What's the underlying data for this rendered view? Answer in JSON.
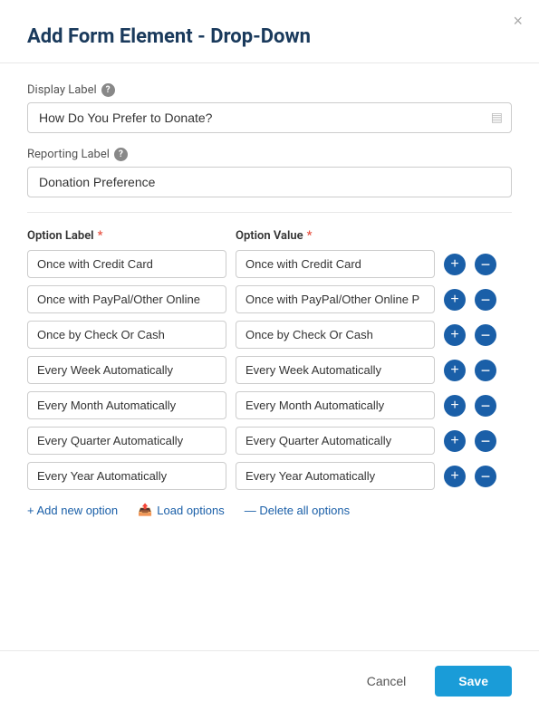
{
  "modal": {
    "title": "Add Form Element - Drop-Down",
    "close_label": "×"
  },
  "display_label": {
    "label": "Display Label",
    "value": "How Do You Prefer to Donate?"
  },
  "reporting_label": {
    "label": "Reporting Label",
    "value": "Donation Preference"
  },
  "options_section": {
    "label_col_header": "Option Label",
    "value_col_header": "Option Value",
    "required_marker": "*",
    "rows": [
      {
        "label": "Once with Credit Card",
        "value": "Once with Credit Card"
      },
      {
        "label": "Once with PayPal/Other Online",
        "value": "Once with PayPal/Other Online P"
      },
      {
        "label": "Once by Check Or Cash",
        "value": "Once by Check Or Cash"
      },
      {
        "label": "Every Week Automatically",
        "value": "Every Week Automatically"
      },
      {
        "label": "Every Month Automatically",
        "value": "Every Month Automatically"
      },
      {
        "label": "Every Quarter Automatically",
        "value": "Every Quarter Automatically"
      },
      {
        "label": "Every Year Automatically",
        "value": "Every Year Automatically"
      }
    ]
  },
  "actions": {
    "add_option": "+ Add new option",
    "load_options": "Load options",
    "delete_all": "— Delete all options"
  },
  "footer": {
    "cancel": "Cancel",
    "save": "Save"
  }
}
